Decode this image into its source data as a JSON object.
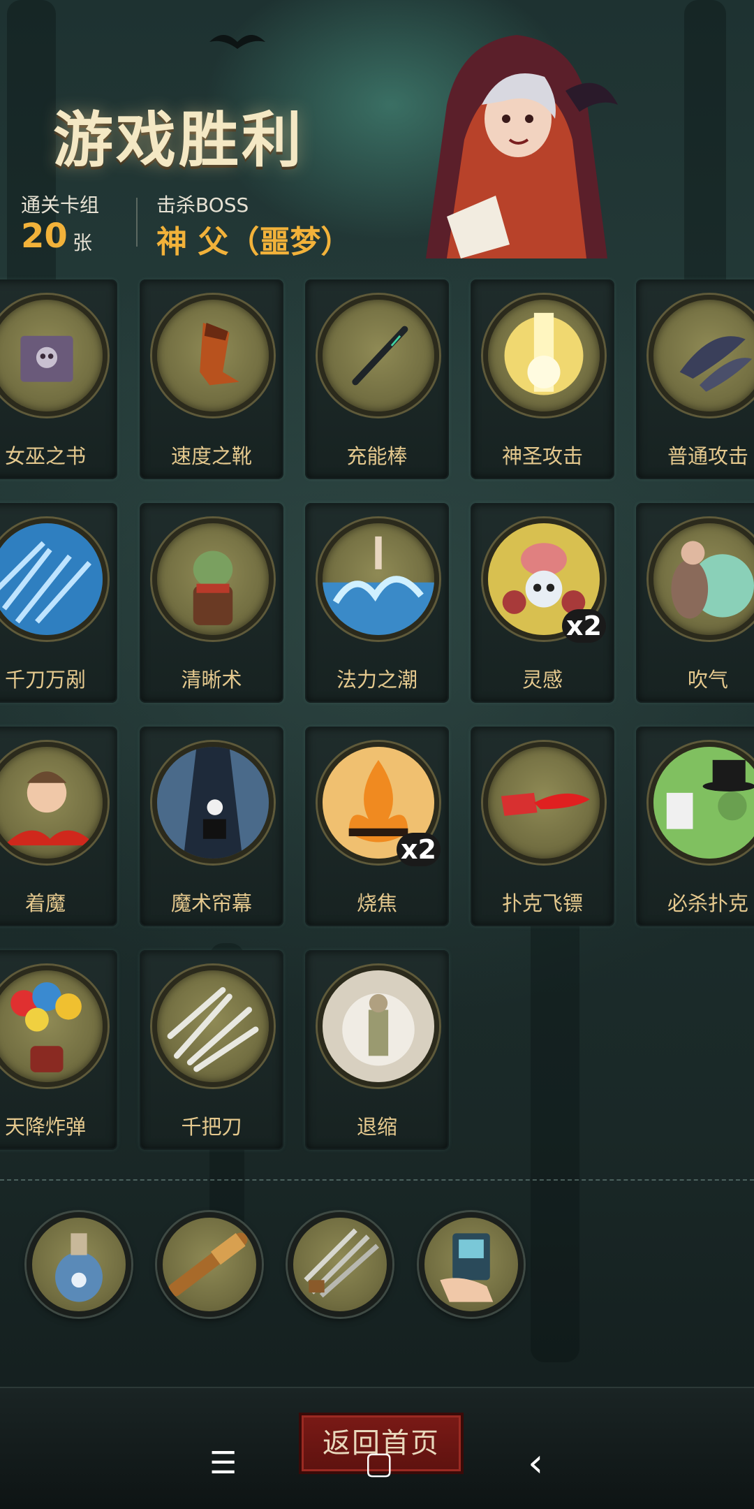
{
  "header": {
    "title": "游戏胜利",
    "stage_label": "通关卡组",
    "stage_count": "20",
    "stage_unit": "张",
    "boss_label": "击杀BOSS",
    "boss_name": "神 父（噩梦）"
  },
  "cards": [
    {
      "name": "女巫之书",
      "icon": "book-icon"
    },
    {
      "name": "速度之靴",
      "icon": "boot-icon"
    },
    {
      "name": "充能棒",
      "icon": "wand-icon"
    },
    {
      "name": "神圣攻击",
      "icon": "holy-light-icon"
    },
    {
      "name": "普通攻击",
      "icon": "feather-slash-icon"
    },
    {
      "name": "千刀万剐",
      "icon": "blade-storm-icon"
    },
    {
      "name": "清晰术",
      "icon": "goblin-icon"
    },
    {
      "name": "法力之潮",
      "icon": "wave-icon"
    },
    {
      "name": "灵感",
      "icon": "brain-skull-icon",
      "multiplier": "x2"
    },
    {
      "name": "吹气",
      "icon": "bubble-man-icon"
    },
    {
      "name": "着魔",
      "icon": "possessed-icon"
    },
    {
      "name": "魔术帘幕",
      "icon": "curtain-hat-icon"
    },
    {
      "name": "烧焦",
      "icon": "fire-icon",
      "multiplier": "x2"
    },
    {
      "name": "扑克飞镖",
      "icon": "card-dart-icon"
    },
    {
      "name": "必杀扑克",
      "icon": "magician-icon"
    },
    {
      "name": "天降炸弹",
      "icon": "balloon-bomb-icon"
    },
    {
      "name": "千把刀",
      "icon": "knives-icon"
    },
    {
      "name": "退缩",
      "icon": "retreat-icon"
    }
  ],
  "relics": [
    {
      "icon": "potion-icon"
    },
    {
      "icon": "spyglass-icon"
    },
    {
      "icon": "crossed-blades-icon"
    },
    {
      "icon": "card-hand-icon"
    }
  ],
  "footer": {
    "home_button": "返回首页"
  },
  "system_nav": {
    "menu": "☰",
    "home": "▢",
    "back": "‹"
  }
}
